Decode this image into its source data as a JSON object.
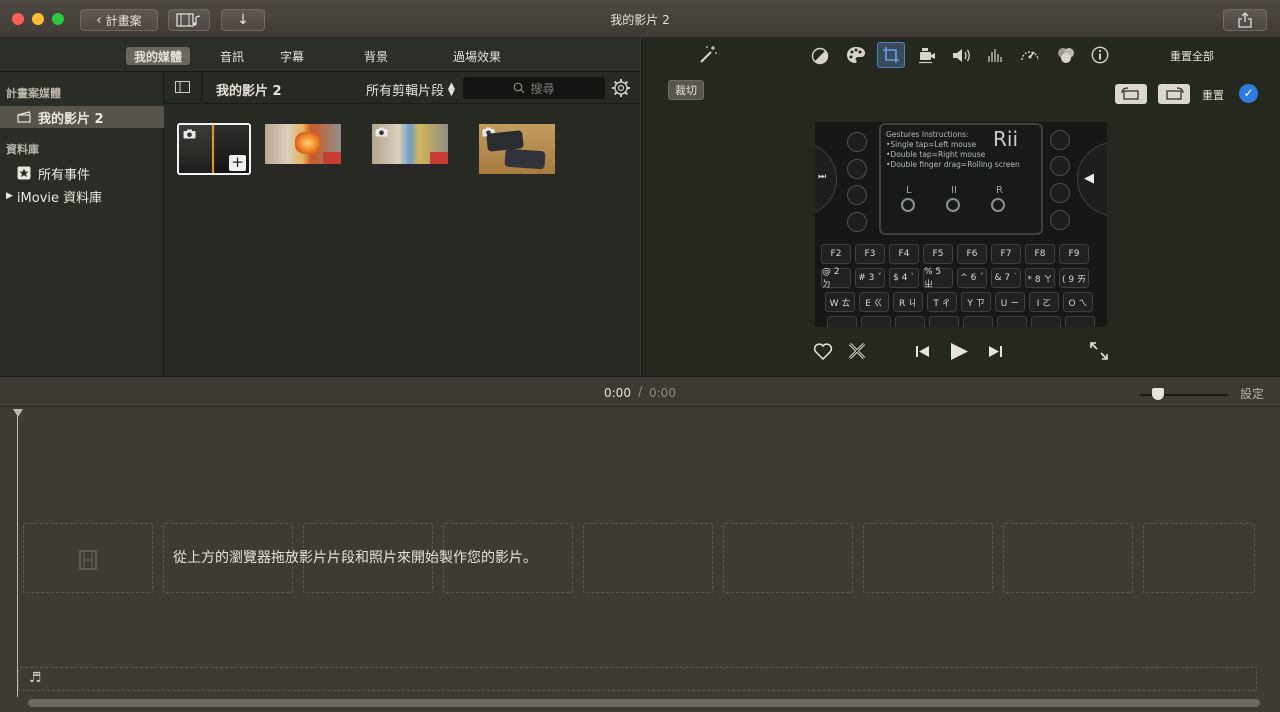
{
  "window": {
    "title": "我的影片 2",
    "back_label": "計畫案"
  },
  "media_tabs": [
    {
      "label": "我的媒體"
    },
    {
      "label": "音訊"
    },
    {
      "label": "字幕"
    },
    {
      "label": "背景"
    },
    {
      "label": "過場效果"
    }
  ],
  "sidebar": {
    "section1": "計畫案媒體",
    "project": "我的影片 2",
    "section2": "資料庫",
    "all_events": "所有事件",
    "library": "iMovie 資料庫"
  },
  "browser": {
    "title": "我的影片 2",
    "filter": "所有剪輯片段",
    "search_placeholder": "搜尋"
  },
  "inspector": {
    "reset_all": "重置全部",
    "crop_label": "裁切",
    "reset_label": "重置"
  },
  "preview_overlay": {
    "gestures_title": "Gestures Instructions:",
    "gesture1": "•Single tap=Left mouse",
    "gesture2": "•Double tap=Right mouse",
    "gesture3": "•Double finger drag=Rolling screen",
    "brand": "Rii",
    "L": "L",
    "mid": "II",
    "R": "R",
    "fkeys": [
      "F2",
      "F3",
      "F4",
      "F5",
      "F6",
      "F7",
      "F8",
      "F9"
    ],
    "row2": [
      "@\n2 ㄉ",
      "#\n3 ˇ",
      "$\n4 ˋ",
      "%\n5 ㄓ",
      "^\n6 ˊ",
      "&\n7 ˙",
      "*\n8 ㄚ",
      "(\n9 ㄞ"
    ],
    "row3": [
      "W ㄊ",
      "E ㄍ",
      "R ㄐ",
      "T ㄔ",
      "Y ㄗ",
      "U ㄧ",
      "I ㄛ",
      "O ㄟ"
    ]
  },
  "timeline": {
    "time_current": "0:00",
    "time_separator": "/",
    "time_total": "0:00",
    "settings_label": "設定",
    "empty_message": "從上方的瀏覽器拖放影片片段和照片來開始製作您的影片。"
  },
  "colors": {
    "accent": "#2d7de0",
    "selection": "#58544c",
    "crop_active": "#4a7fc0"
  }
}
